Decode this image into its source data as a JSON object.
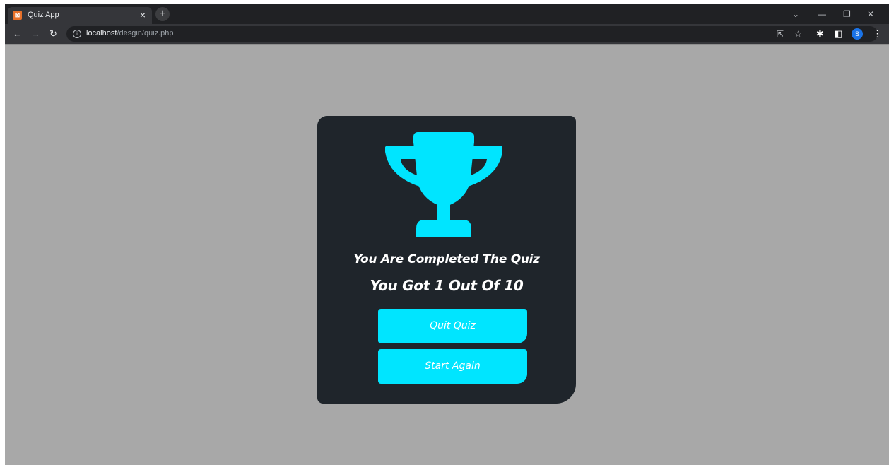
{
  "browser": {
    "tab_title": "Quiz App",
    "tab_close": "×",
    "new_tab": "+",
    "url_host": "localhost",
    "url_path": "/desgin/quiz.php",
    "profile_initial": "S"
  },
  "quiz": {
    "completed_message": "You Are Completed The Quiz",
    "score_message": "You Got 1 Out Of 10",
    "quit_label": "Quit Quiz",
    "restart_label": "Start Again",
    "accent_color": "#00e5ff",
    "card_color": "#1f252b"
  }
}
